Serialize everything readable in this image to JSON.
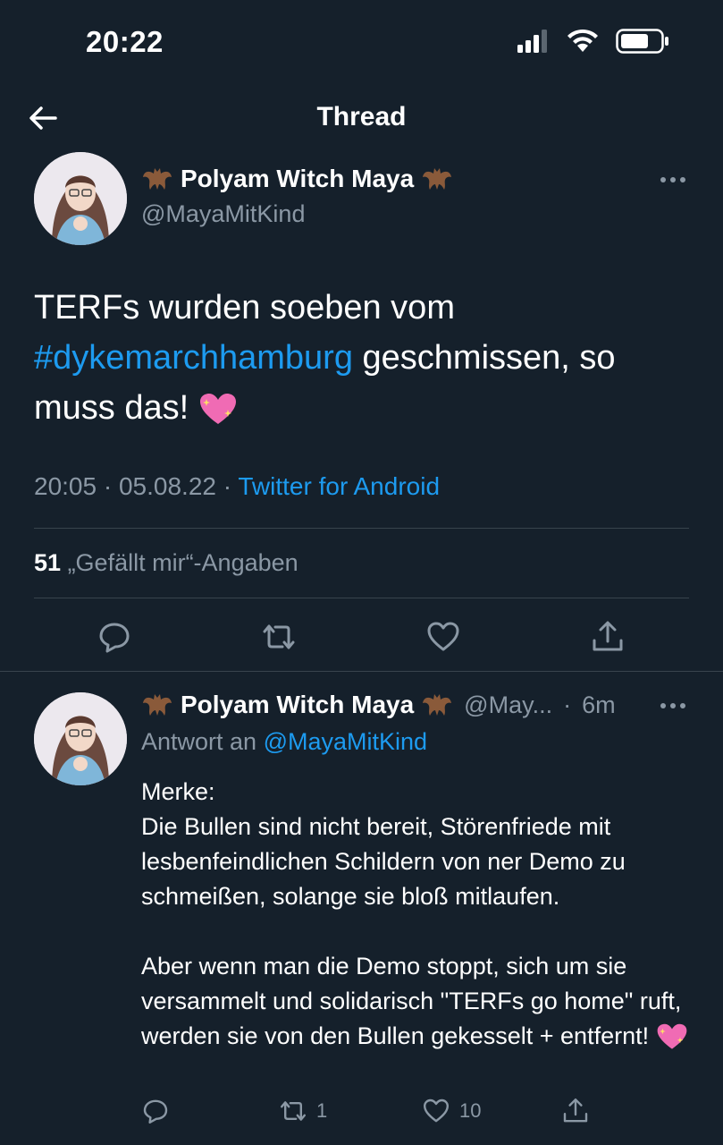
{
  "status_bar": {
    "time": "20:22",
    "icons": [
      "signal-icon",
      "wifi-icon",
      "battery-icon"
    ]
  },
  "nav": {
    "title": "Thread",
    "back_icon": "arrow-left-icon"
  },
  "main_tweet": {
    "author_name": "Polyam Witch Maya",
    "handle": "@MayaMitKind",
    "name_decoration_icon": "bat-emoji",
    "text_part1": "TERFs wurden soeben vom",
    "hashtag": "#dykemarchhamburg",
    "text_part2": " geschmissen, so muss das!",
    "emoji": "sparkling-heart-emoji",
    "time": "20:05",
    "date": "05.08.22",
    "separator": "·",
    "source": "Twitter for Android",
    "likes_count": "51",
    "likes_label": "„Gefällt mir“-Angaben"
  },
  "reply_tweet": {
    "author_name": "Polyam Witch Maya",
    "handle_short": "@May...",
    "separator": "·",
    "time_ago": "6m",
    "reply_to_label": "Antwort an",
    "reply_to_handle": "@MayaMitKind",
    "text": "Merke:\nDie Bullen sind nicht bereit, Störenfriede mit lesbenfeindlichen Schildern von ner Demo zu schmeißen, solange sie bloß mitlaufen.\n\nAber wenn man die Demo stoppt, sich um sie versammelt und solidarisch \"TERFs go home\" ruft, werden sie von den Bullen gekesselt + entfernt!",
    "retweets": "1",
    "likes": "10"
  },
  "colors": {
    "background": "#15202b",
    "accent": "#1d9bf0",
    "muted": "#8b98a5",
    "divider": "#38444d"
  }
}
